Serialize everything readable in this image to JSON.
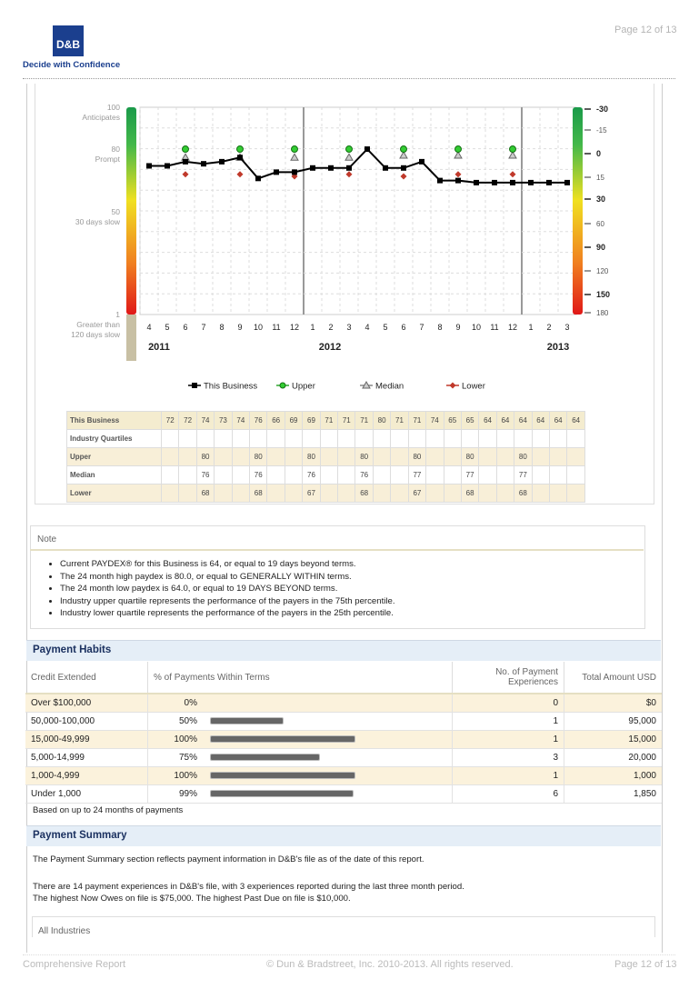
{
  "header": {
    "logo_text": "D&B",
    "tagline": "Decide with Confidence",
    "page_label": "Page 12 of 13"
  },
  "chart": {
    "left_labels": [
      {
        "value": "100",
        "desc": "Anticipates"
      },
      {
        "value": "80",
        "desc": "Prompt"
      },
      {
        "value": "50",
        "desc": "30 days slow"
      },
      {
        "value": "1",
        "desc": "Greater than",
        "desc2": "120 days slow"
      }
    ],
    "right_ticks": [
      "-30",
      "-15",
      "0",
      "15",
      "30",
      "60",
      "90",
      "120",
      "150",
      "180"
    ],
    "right_bold": [
      "-30",
      "0",
      "30",
      "90",
      "150"
    ],
    "x_months": [
      "4",
      "5",
      "6",
      "7",
      "8",
      "9",
      "10",
      "11",
      "12",
      "1",
      "2",
      "3",
      "4",
      "5",
      "6",
      "7",
      "8",
      "9",
      "10",
      "11",
      "12",
      "1",
      "2",
      "3"
    ],
    "years": [
      "2011",
      "2012",
      "2013"
    ],
    "legend": [
      "This Business",
      "Upper",
      "Median",
      "Lower"
    ],
    "colors": {
      "this_business": "#000000",
      "upper": "#2fa82f",
      "median": "#888888",
      "lower": "#c0392b"
    }
  },
  "chart_data": {
    "type": "line",
    "x": [
      "4",
      "5",
      "6",
      "7",
      "8",
      "9",
      "10",
      "11",
      "12",
      "1",
      "2",
      "3",
      "4",
      "5",
      "6",
      "7",
      "8",
      "9",
      "10",
      "11",
      "12",
      "1",
      "2",
      "3"
    ],
    "ylim": [
      1,
      100
    ],
    "series": [
      {
        "name": "This Business",
        "values": [
          72,
          72,
          74,
          73,
          74,
          76,
          66,
          69,
          69,
          71,
          71,
          71,
          80,
          71,
          71,
          74,
          65,
          65,
          64,
          64,
          64,
          64,
          64,
          64
        ]
      },
      {
        "name": "Upper",
        "values": [
          null,
          null,
          80,
          null,
          null,
          80,
          null,
          null,
          80,
          null,
          null,
          80,
          null,
          null,
          80,
          null,
          null,
          80,
          null,
          null,
          80,
          null,
          null,
          null
        ]
      },
      {
        "name": "Median",
        "values": [
          null,
          null,
          76,
          null,
          null,
          76,
          null,
          null,
          76,
          null,
          null,
          76,
          null,
          null,
          77,
          null,
          null,
          77,
          null,
          null,
          77,
          null,
          null,
          null
        ]
      },
      {
        "name": "Lower",
        "values": [
          null,
          null,
          68,
          null,
          null,
          68,
          null,
          null,
          67,
          null,
          null,
          68,
          null,
          null,
          67,
          null,
          null,
          68,
          null,
          null,
          68,
          null,
          null,
          null
        ]
      }
    ]
  },
  "paydex_table": {
    "rows": [
      {
        "label": "This Business",
        "cells": [
          "72",
          "72",
          "74",
          "73",
          "74",
          "76",
          "66",
          "69",
          "69",
          "71",
          "71",
          "71",
          "80",
          "71",
          "71",
          "74",
          "65",
          "65",
          "64",
          "64",
          "64",
          "64",
          "64",
          "64"
        ]
      },
      {
        "label": "Industry Quartiles",
        "cells": [
          "",
          "",
          "",
          "",
          "",
          "",
          "",
          "",
          "",
          "",
          "",
          "",
          "",
          "",
          "",
          "",
          "",
          "",
          "",
          "",
          "",
          "",
          "",
          ""
        ]
      },
      {
        "label": "Upper",
        "cells": [
          "",
          "",
          "80",
          "",
          "",
          "80",
          "",
          "",
          "80",
          "",
          "",
          "80",
          "",
          "",
          "80",
          "",
          "",
          "80",
          "",
          "",
          "80",
          "",
          "",
          ""
        ]
      },
      {
        "label": "Median",
        "cells": [
          "",
          "",
          "76",
          "",
          "",
          "76",
          "",
          "",
          "76",
          "",
          "",
          "76",
          "",
          "",
          "77",
          "",
          "",
          "77",
          "",
          "",
          "77",
          "",
          "",
          ""
        ]
      },
      {
        "label": "Lower",
        "cells": [
          "",
          "",
          "68",
          "",
          "",
          "68",
          "",
          "",
          "67",
          "",
          "",
          "68",
          "",
          "",
          "67",
          "",
          "",
          "68",
          "",
          "",
          "68",
          "",
          "",
          ""
        ]
      }
    ]
  },
  "note": {
    "title": "Note",
    "items": [
      "Current PAYDEX® for this Business is 64, or equal to 19 days beyond terms.",
      "The 24 month high paydex is 80.0, or equal to GENERALLY WITHIN terms.",
      "The 24 month low paydex is 64.0, or equal to 19 DAYS BEYOND terms.",
      "Industry upper quartile represents the performance of the payers in the 75th percentile.",
      "Industry lower quartile represents the performance of the payers in the 25th percentile."
    ]
  },
  "payment_habits": {
    "title": "Payment Habits",
    "columns": [
      "Credit Extended",
      "% of Payments Within Terms",
      "No. of Payment Experiences",
      "Total Amount USD"
    ],
    "rows": [
      {
        "credit": "Over $100,000",
        "pct": "0%",
        "pct_value": 0,
        "count": "0",
        "amount": "$0"
      },
      {
        "credit": "50,000-100,000",
        "pct": "50%",
        "pct_value": 50,
        "count": "1",
        "amount": "95,000"
      },
      {
        "credit": "15,000-49,999",
        "pct": "100%",
        "pct_value": 100,
        "count": "1",
        "amount": "15,000"
      },
      {
        "credit": "5,000-14,999",
        "pct": "75%",
        "pct_value": 75,
        "count": "3",
        "amount": "20,000"
      },
      {
        "credit": "1,000-4,999",
        "pct": "100%",
        "pct_value": 100,
        "count": "1",
        "amount": "1,000"
      },
      {
        "credit": "Under 1,000",
        "pct": "99%",
        "pct_value": 99,
        "count": "6",
        "amount": "1,850"
      }
    ],
    "footnote": "Based on up to 24 months of payments"
  },
  "payment_summary": {
    "title": "Payment Summary",
    "p1": "The Payment Summary section reflects payment information in D&B's file as of the date of this report.",
    "p2_line1": "There are 14 payment experiences in D&B's file, with 3 experiences reported during the last three month period.",
    "p2_line2": "The highest Now Owes on file is $75,000.  The highest Past Due on file is $10,000.",
    "subbox": "All Industries"
  },
  "footer": {
    "left": "Comprehensive Report",
    "center": "© Dun & Bradstreet, Inc. 2010-2013. All rights reserved.",
    "right": "Page 12 of 13"
  }
}
